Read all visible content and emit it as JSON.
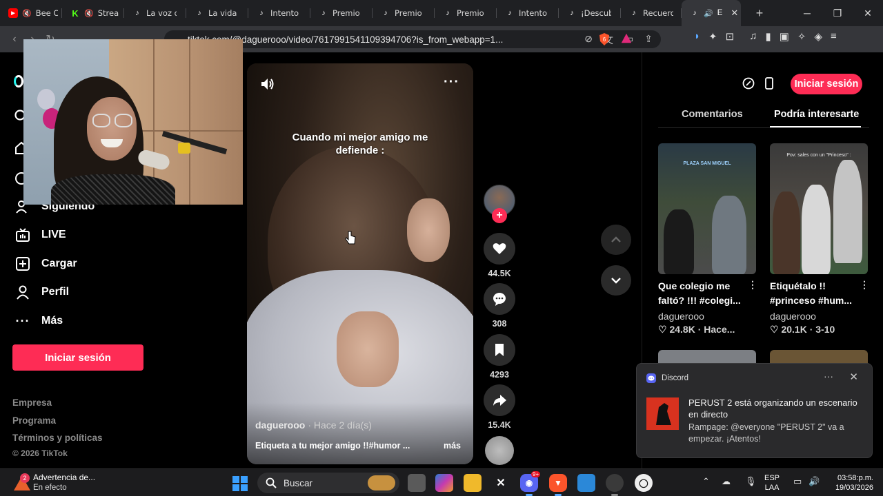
{
  "browser": {
    "tabs": [
      {
        "label": "Bee C",
        "favicon": "youtube-icon",
        "muted": true
      },
      {
        "label": "Strea",
        "favicon": "kick-icon",
        "muted": true
      },
      {
        "label": "La voz d",
        "favicon": "tiktok-icon"
      },
      {
        "label": "La vida d",
        "favicon": "tiktok-icon"
      },
      {
        "label": "Intento f",
        "favicon": "tiktok-icon"
      },
      {
        "label": "Premio a",
        "favicon": "tiktok-icon"
      },
      {
        "label": "Premio a",
        "favicon": "tiktok-icon"
      },
      {
        "label": "Premio a",
        "favicon": "tiktok-icon"
      },
      {
        "label": "Intento f",
        "favicon": "tiktok-icon"
      },
      {
        "label": "¡Descub",
        "favicon": "tiktok-icon"
      },
      {
        "label": "Recuerd",
        "favicon": "tiktok-icon"
      },
      {
        "label": "E",
        "favicon": "tiktok-icon",
        "active": true,
        "audible": true
      }
    ],
    "url": "tiktok.com/@daguerooo/video/7617991541109394706?is_from_webapp=1...",
    "brave_badge": "6"
  },
  "sidebar": {
    "items": [
      {
        "label": "Siguiendo",
        "icon": "following-icon"
      },
      {
        "label": "LIVE",
        "icon": "live-icon"
      },
      {
        "label": "Cargar",
        "icon": "upload-icon"
      },
      {
        "label": "Perfil",
        "icon": "profile-icon"
      },
      {
        "label": "Más",
        "icon": "more-icon"
      }
    ],
    "login_label": "Iniciar sesión",
    "footer": [
      "Empresa",
      "Programa",
      "Términos y políticas",
      "© 2026 TikTok"
    ]
  },
  "video": {
    "caption": "Cuando mi mejor amigo me defiende :",
    "author": "daguerooo",
    "posted": "· Hace 2 día(s)",
    "description": "Etiqueta a tu mejor amigo !!#humor ...",
    "more_label": "más",
    "likes": "44.5K",
    "comments": "308",
    "saves": "4293",
    "shares": "15.4K",
    "follow_label": "+"
  },
  "right_panel": {
    "login_label": "Iniciar sesión",
    "tabs": [
      "Comentarios",
      "Podría interesarte"
    ],
    "active_tab": 1,
    "recommendations": [
      {
        "title": "Que colegio me faltó? !!! #colegi...",
        "author": "daguerooo",
        "likes": "24.8K",
        "date": "· Hace...",
        "thumb_text": "PLAZA SAN MIGUEL"
      },
      {
        "title": "Etiquétalo !! #princeso #hum...",
        "author": "daguerooo",
        "likes": "20.1K",
        "date": "· 3-10",
        "thumb_text": "Pov: sales con un \"Princeso\" :"
      }
    ]
  },
  "notification": {
    "app": "Discord",
    "title": "PERUST 2 está organizando un escenario en directo",
    "body": "Rampage: @everyone \"PERUST 2\" va a empezar. ¡Atentos!"
  },
  "taskbar": {
    "warning_title": "Advertencia de...",
    "warning_sub": "En efecto",
    "warning_badge": "2",
    "search_placeholder": "Buscar",
    "discord_badge": "9+",
    "lang_top": "ESP",
    "lang_bottom": "LAA",
    "time": "03:58:p.m.",
    "date": "19/03/2026"
  },
  "colors": {
    "accent": "#fe2c55",
    "discord": "#5865f2"
  }
}
